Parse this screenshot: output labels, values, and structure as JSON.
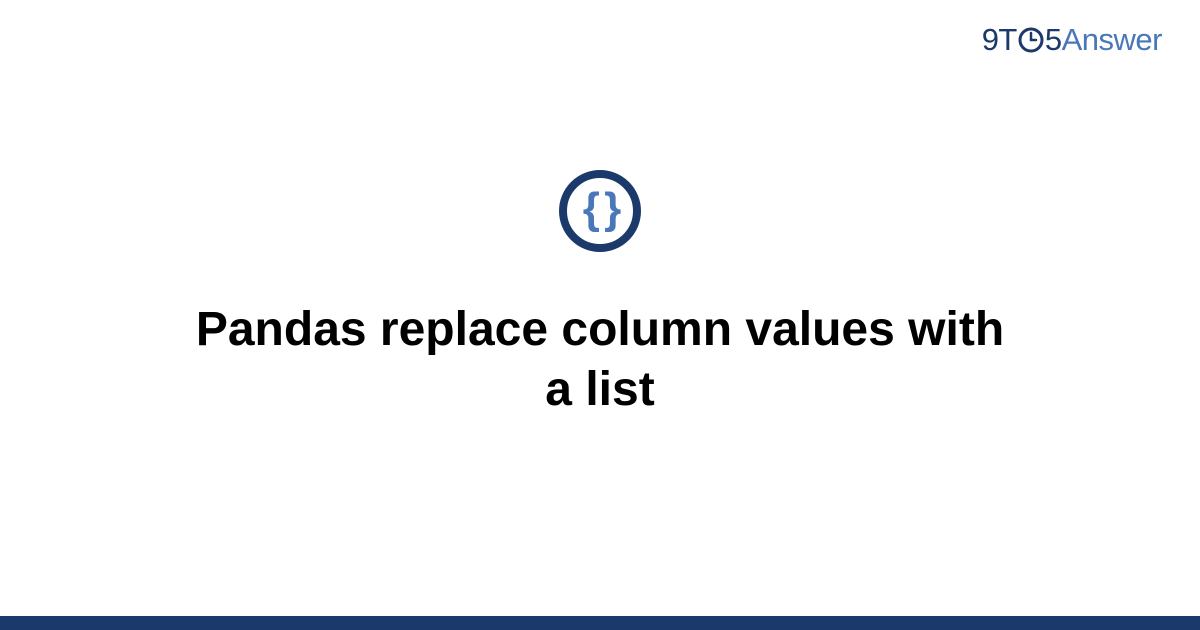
{
  "header": {
    "logo_part1": "9T",
    "logo_part2": "5",
    "logo_part3": "Answer"
  },
  "main": {
    "icon_glyph": "{ }",
    "title": "Pandas replace column values with a list"
  },
  "colors": {
    "brand_dark": "#1b3a6b",
    "brand_light": "#4a77b8"
  }
}
